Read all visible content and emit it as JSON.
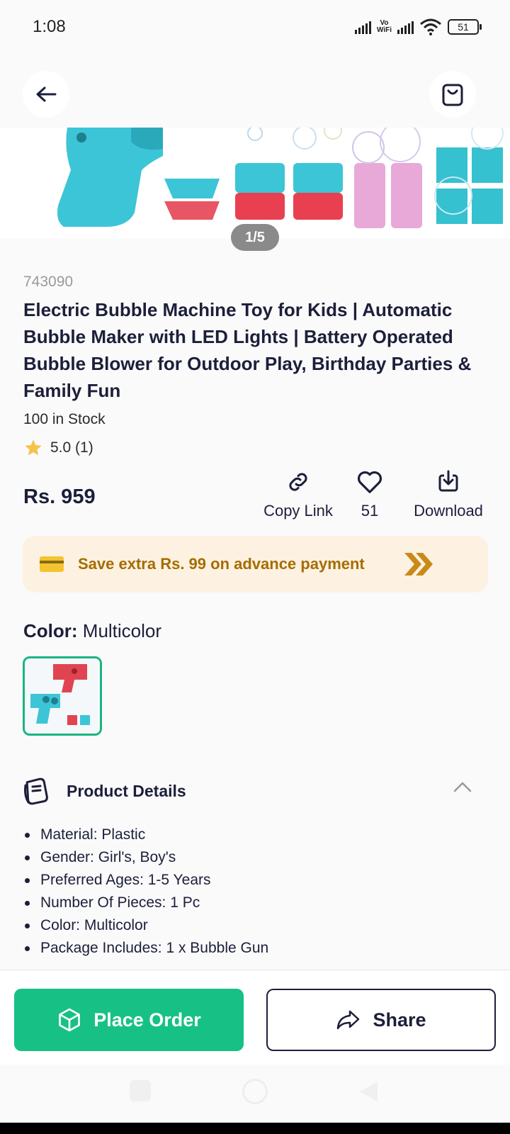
{
  "status_bar": {
    "time": "1:08",
    "vowifi_top": "Vo",
    "vowifi_bottom": "WiFi",
    "battery": "51"
  },
  "header": {
    "back_icon": "arrow-left-icon",
    "bag_icon": "shopping-bag-icon"
  },
  "gallery": {
    "indicator": "1/5"
  },
  "product": {
    "sku": "743090",
    "title": "Electric Bubble Machine Toy for Kids | Automatic Bubble Maker with LED Lights | Battery Operated Bubble Blower for Outdoor Play, Birthday Parties & Family Fun",
    "stock": "100 in Stock",
    "rating": "5.0 (1)",
    "price": "Rs. 959"
  },
  "actions": {
    "copy_link": "Copy Link",
    "likes": "51",
    "download": "Download"
  },
  "promo": {
    "text": "Save extra Rs. 99 on advance payment"
  },
  "color": {
    "label": "Color:",
    "value": "Multicolor"
  },
  "details": {
    "title": "Product Details",
    "items": [
      "Material: Plastic",
      "Gender: Girl's, Boy's",
      "Preferred Ages: 1-5 Years",
      "Number Of Pieces: 1 Pc",
      "Color: Multicolor",
      "Package Includes: 1 x Bubble Gun"
    ]
  },
  "bottom": {
    "place_order": "Place Order",
    "share": "Share"
  },
  "colors": {
    "accent_green": "#17c185",
    "promo_bg": "#fdf2e1",
    "promo_text": "#a66c00",
    "navy": "#1c1f3a"
  }
}
